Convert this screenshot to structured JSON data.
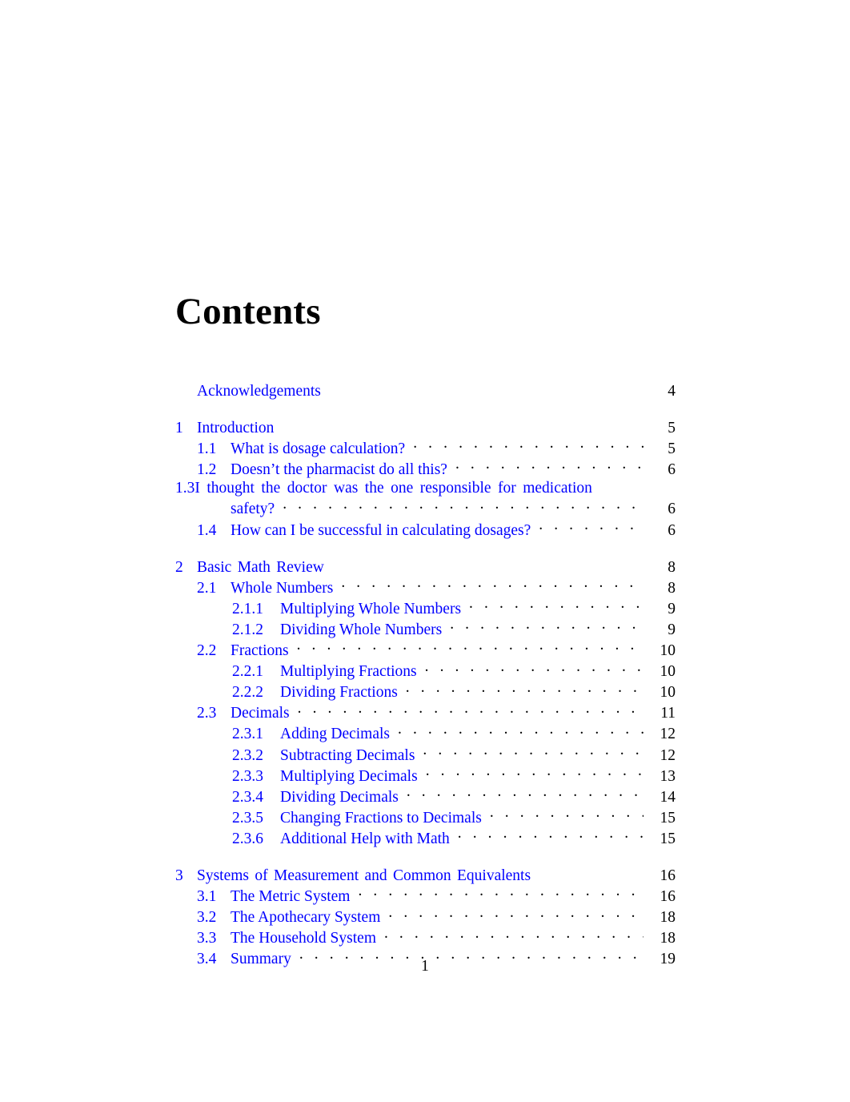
{
  "document": {
    "title": "Contents",
    "folio": "1",
    "link_color": "#0000ff",
    "text_color": "#000000",
    "background_color": "#ffffff"
  },
  "toc": {
    "entries": [
      {
        "level": "chapter",
        "number": "",
        "title": "Acknowledgements",
        "page": "4",
        "dots": false
      },
      {
        "level": "chapter",
        "number": "1",
        "title": "Introduction",
        "page": "5",
        "dots": false
      },
      {
        "level": "section",
        "number": "1.1",
        "title": "What is dosage calculation?",
        "page": "5",
        "dots": true
      },
      {
        "level": "section",
        "number": "1.2",
        "title": "Doesn’t the pharmacist do all this?",
        "page": "6",
        "dots": true
      },
      {
        "level": "section",
        "number": "1.3",
        "title": "I thought the doctor was the one responsible for medication safety?",
        "title_line1": "I thought the doctor was the one responsible for medication",
        "title_line2": "safety?",
        "page": "6",
        "dots": true,
        "wrapped": true
      },
      {
        "level": "section",
        "number": "1.4",
        "title": "How can I be successful in calculating dosages?",
        "page": "6",
        "dots": true
      },
      {
        "level": "chapter",
        "number": "2",
        "title": "Basic Math Review",
        "page": "8",
        "dots": false
      },
      {
        "level": "section",
        "number": "2.1",
        "title": "Whole Numbers",
        "page": "8",
        "dots": true
      },
      {
        "level": "subsection",
        "number": "2.1.1",
        "title": "Multiplying Whole Numbers",
        "page": "9",
        "dots": true
      },
      {
        "level": "subsection",
        "number": "2.1.2",
        "title": "Dividing Whole Numbers",
        "page": "9",
        "dots": true
      },
      {
        "level": "section",
        "number": "2.2",
        "title": "Fractions",
        "page": "10",
        "dots": true
      },
      {
        "level": "subsection",
        "number": "2.2.1",
        "title": "Multiplying Fractions",
        "page": "10",
        "dots": true
      },
      {
        "level": "subsection",
        "number": "2.2.2",
        "title": "Dividing Fractions",
        "page": "10",
        "dots": true
      },
      {
        "level": "section",
        "number": "2.3",
        "title": "Decimals",
        "page": "11",
        "dots": true
      },
      {
        "level": "subsection",
        "number": "2.3.1",
        "title": "Adding Decimals",
        "page": "12",
        "dots": true
      },
      {
        "level": "subsection",
        "number": "2.3.2",
        "title": "Subtracting Decimals",
        "page": "12",
        "dots": true
      },
      {
        "level": "subsection",
        "number": "2.3.3",
        "title": "Multiplying Decimals",
        "page": "13",
        "dots": true
      },
      {
        "level": "subsection",
        "number": "2.3.4",
        "title": "Dividing Decimals",
        "page": "14",
        "dots": true
      },
      {
        "level": "subsection",
        "number": "2.3.5",
        "title": "Changing Fractions to Decimals",
        "page": "15",
        "dots": true
      },
      {
        "level": "subsection",
        "number": "2.3.6",
        "title": "Additional Help with Math",
        "page": "15",
        "dots": true
      },
      {
        "level": "chapter",
        "number": "3",
        "title": "Systems of Measurement and Common Equivalents",
        "page": "16",
        "dots": false
      },
      {
        "level": "section",
        "number": "3.1",
        "title": "The Metric System",
        "page": "16",
        "dots": true
      },
      {
        "level": "section",
        "number": "3.2",
        "title": "The Apothecary System",
        "page": "18",
        "dots": true
      },
      {
        "level": "section",
        "number": "3.3",
        "title": "The Household System",
        "page": "18",
        "dots": true
      },
      {
        "level": "section",
        "number": "3.4",
        "title": "Summary",
        "page": "19",
        "dots": true
      }
    ]
  }
}
